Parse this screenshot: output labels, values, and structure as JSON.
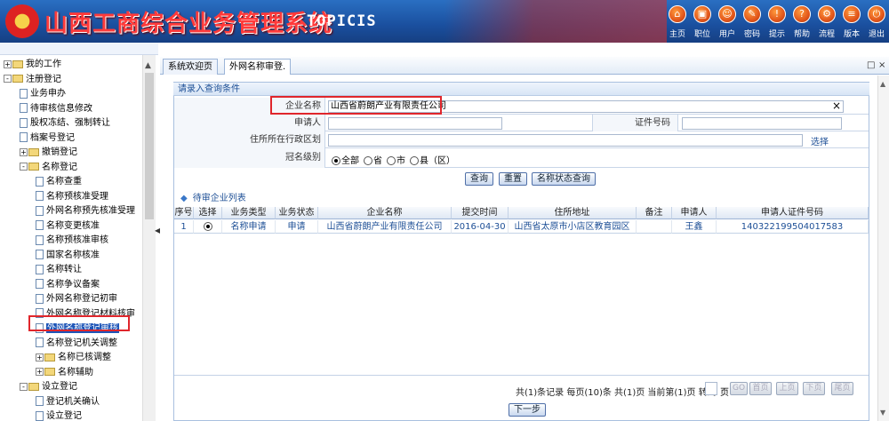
{
  "header": {
    "title": "山西工商综合业务管理系统",
    "brand": "TOPICIS",
    "toolbar": [
      {
        "label": "主页",
        "icon": "home-icon",
        "glyph": "⌂"
      },
      {
        "label": "职位",
        "icon": "position-icon",
        "glyph": "▣"
      },
      {
        "label": "用户",
        "icon": "user-icon",
        "glyph": "☺"
      },
      {
        "label": "密码",
        "icon": "password-icon",
        "glyph": "✎"
      },
      {
        "label": "提示",
        "icon": "tip-icon",
        "glyph": "!"
      },
      {
        "label": "帮助",
        "icon": "help-icon",
        "glyph": "?"
      },
      {
        "label": "流程",
        "icon": "workflow-icon",
        "glyph": "⚙"
      },
      {
        "label": "版本",
        "icon": "version-icon",
        "glyph": "≡"
      },
      {
        "label": "退出",
        "icon": "exit-icon",
        "glyph": "⏻"
      }
    ]
  },
  "sidebar": {
    "items": [
      {
        "label": "我的工作",
        "level": 0,
        "type": "folder",
        "toggle": "+"
      },
      {
        "label": "注册登记",
        "level": 0,
        "type": "folder",
        "toggle": "-"
      },
      {
        "label": "业务申办",
        "level": 1,
        "type": "doc"
      },
      {
        "label": "待审核信息修改",
        "level": 1,
        "type": "doc"
      },
      {
        "label": "股权冻结、强制转让",
        "level": 1,
        "type": "doc"
      },
      {
        "label": "档案号登记",
        "level": 1,
        "type": "doc"
      },
      {
        "label": "撤销登记",
        "level": 1,
        "type": "folder",
        "toggle": "+"
      },
      {
        "label": "名称登记",
        "level": 1,
        "type": "folder",
        "toggle": "-"
      },
      {
        "label": "名称查重",
        "level": 2,
        "type": "doc"
      },
      {
        "label": "名称预核准受理",
        "level": 2,
        "type": "doc"
      },
      {
        "label": "外网名称预先核准受理",
        "level": 2,
        "type": "doc"
      },
      {
        "label": "名称变更核准",
        "level": 2,
        "type": "doc"
      },
      {
        "label": "名称预核准审核",
        "level": 2,
        "type": "doc"
      },
      {
        "label": "国家名称核准",
        "level": 2,
        "type": "doc"
      },
      {
        "label": "名称转让",
        "level": 2,
        "type": "doc"
      },
      {
        "label": "名称争议备案",
        "level": 2,
        "type": "doc"
      },
      {
        "label": "外网名称登记初审",
        "level": 2,
        "type": "doc"
      },
      {
        "label": "外网名称登记材料核审",
        "level": 2,
        "type": "doc"
      },
      {
        "label": "外网名称登记审核",
        "level": 2,
        "type": "doc",
        "selected": true
      },
      {
        "label": "名称登记机关调整",
        "level": 2,
        "type": "doc"
      },
      {
        "label": "名称已核调整",
        "level": 2,
        "type": "folder",
        "toggle": "+"
      },
      {
        "label": "名称辅助",
        "level": 2,
        "type": "folder",
        "toggle": "+"
      },
      {
        "label": "设立登记",
        "level": 1,
        "type": "folder",
        "toggle": "-"
      },
      {
        "label": "登记机关确认",
        "level": 2,
        "type": "doc"
      },
      {
        "label": "设立登记",
        "level": 2,
        "type": "doc"
      }
    ]
  },
  "tabs": [
    {
      "label": "系统欢迎页",
      "active": false
    },
    {
      "label": "外网名称审登.",
      "active": true
    }
  ],
  "form": {
    "section_title": "请录入查询条件",
    "company_name_label": "企业名称",
    "company_name_value": "山西省蔚朗产业有限责任公司",
    "clear_glyph": "×",
    "applicant_label": "申请人",
    "applicant_value": "",
    "id_label": "证件号码",
    "id_value": "",
    "region_label": "住所所在行政区划",
    "region_value": "",
    "select_link": "选择",
    "level_label": "冠名级别",
    "level_options": [
      {
        "label": "全部",
        "checked": true
      },
      {
        "label": "省",
        "checked": false
      },
      {
        "label": "市",
        "checked": false
      },
      {
        "label": "县（区）",
        "checked": false
      }
    ]
  },
  "buttons": {
    "query": "查询",
    "reset": "重置",
    "status_query": "名称状态查询",
    "next": "下一步"
  },
  "list": {
    "title": "待审企业列表",
    "columns": [
      "序号",
      "选择",
      "业务类型",
      "业务状态",
      "企业名称",
      "提交时间",
      "住所地址",
      "备注",
      "申请人",
      "申请人证件号码"
    ],
    "rows": [
      [
        "1",
        "",
        "名称申请",
        "申请",
        "山西省蔚朗产业有限责任公司",
        "2016-04-30",
        "山西省太原市小店区教育园区",
        "",
        "王鑫",
        "140322199504017583"
      ]
    ]
  },
  "pager": {
    "summary": "共(1)条记录  每页(10)条  共(1)页  当前第(1)页  转到",
    "page_unit": "页",
    "buttons": [
      "GO",
      "首页",
      "上页",
      "下页",
      "尾页"
    ]
  }
}
